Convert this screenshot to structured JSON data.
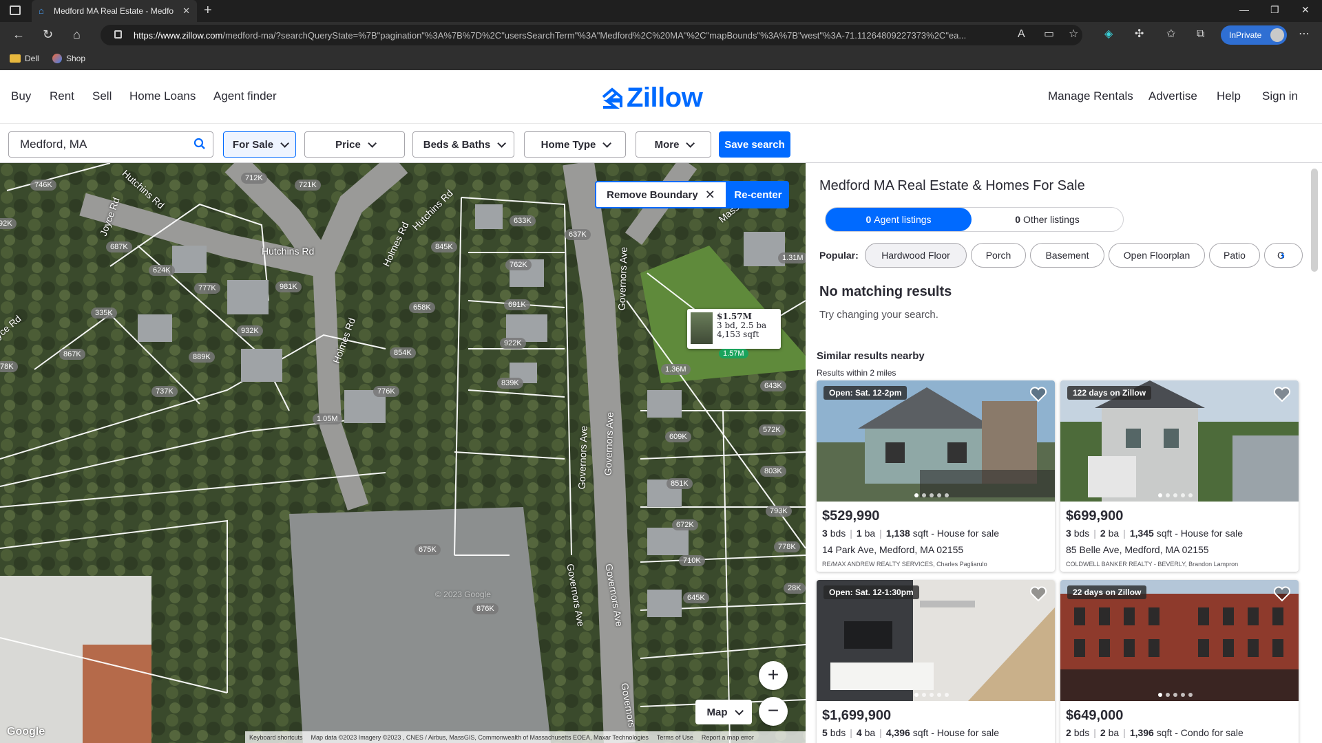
{
  "browser": {
    "tab_title": "Medford MA Real Estate - Medfo",
    "url_host": "https://www.zillow.com",
    "url_path": "/medford-ma/?searchQueryState=%7B\"pagination\"%3A%7B%7D%2C\"usersSearchTerm\"%3A\"Medford%2C%20MA\"%2C\"mapBounds\"%3A%7B\"west\"%3A-71.11264809227373%2C\"ea...",
    "inprivate_label": "InPrivate",
    "favorites": [
      "Dell",
      "Shop"
    ]
  },
  "header": {
    "nav_left": [
      "Buy",
      "Rent",
      "Sell",
      "Home Loans",
      "Agent finder"
    ],
    "logo_text": "Zillow",
    "nav_right": [
      "Manage Rentals",
      "Advertise",
      "Help",
      "Sign in"
    ]
  },
  "filters": {
    "search_value": "Medford, MA",
    "buttons": [
      "For Sale",
      "Price",
      "Beds & Baths",
      "Home Type",
      "More"
    ],
    "save_label": "Save search"
  },
  "map": {
    "remove_boundary": "Remove Boundary",
    "recenter": "Re-center",
    "map_type": "Map",
    "zoom_in": "+",
    "zoom_out": "−",
    "popup": {
      "price": "$1.57M",
      "beds_baths": "3 bd, 2.5 ba",
      "sqft": "4,153 sqft"
    },
    "green_pin": "1.57M",
    "price_labels": [
      "746K",
      "712K",
      "721K",
      "92K",
      "687K",
      "624K",
      "777K",
      "981K",
      "335K",
      "932K",
      "889K",
      "867K",
      "78K",
      "737K",
      "633K",
      "637K",
      "845K",
      "762K",
      "691K",
      "658K",
      "922K",
      "854K",
      "839K",
      "776K",
      "1.05M",
      "1.31M",
      "1.36M",
      "643K",
      "609K",
      "572K",
      "803K",
      "851K",
      "793K",
      "672K",
      "778K",
      "710K",
      "645K",
      "28K",
      "675K",
      "876K"
    ],
    "streets": [
      "Hutchins Rd",
      "Hutchins Rd",
      "Joyce Rd",
      "Hutchins Rd",
      "Holmes Rd",
      "Holmes Rd",
      "Governors Ave",
      "Governors Ave",
      "Governors Ave",
      "Governors Ave",
      "Governors Ave",
      "Governors",
      "Massac",
      "yce Rd"
    ],
    "watermark": "© 2023 Google",
    "google": "Google",
    "attribution": [
      "Keyboard shortcuts",
      "Map data ©2023 Imagery ©2023 , CNES / Airbus, MassGIS, Commonwealth of Massachusetts EOEA, Maxar Technologies",
      "Terms of Use",
      "Report a map error"
    ]
  },
  "panel": {
    "title": "Medford MA Real Estate & Homes For Sale",
    "agent_count": "0",
    "agent_label": "Agent listings",
    "other_count": "0",
    "other_label": "Other listings",
    "popular_label": "Popular:",
    "chips": [
      "Hardwood Floor",
      "Porch",
      "Basement",
      "Open Floorplan",
      "Patio",
      "G"
    ],
    "no_match": "No matching results",
    "try_change": "Try changing your search.",
    "similar": "Similar results nearby",
    "within": "Results within 2 miles",
    "cards": [
      {
        "badge": "Open: Sat. 12-2pm",
        "price": "$529,990",
        "beds": "3",
        "beds_u": "bds",
        "baths": "1",
        "baths_u": "ba",
        "sqft": "1,138",
        "sqft_u": "sqft",
        "type": "- House for sale",
        "address": "14 Park Ave, Medford, MA 02155",
        "brokerage": "RE/MAX ANDREW REALTY SERVICES,",
        "agent": "Charles Pagliarulo"
      },
      {
        "badge": "122 days on Zillow",
        "price": "$699,900",
        "beds": "3",
        "beds_u": "bds",
        "baths": "2",
        "baths_u": "ba",
        "sqft": "1,345",
        "sqft_u": "sqft",
        "type": "- House for sale",
        "address": "85 Belle Ave, Medford, MA 02155",
        "brokerage": "COLDWELL BANKER REALTY - BEVERLY,",
        "agent": "Brandon Lampron"
      },
      {
        "badge": "Open: Sat. 12-1:30pm",
        "price": "$1,699,900",
        "beds": "5",
        "beds_u": "bds",
        "baths": "4",
        "baths_u": "ba",
        "sqft": "4,396",
        "sqft_u": "sqft",
        "type": "- House for sale",
        "address": "",
        "brokerage": "",
        "agent": ""
      },
      {
        "badge": "22 days on Zillow",
        "price": "$649,000",
        "beds": "2",
        "beds_u": "bds",
        "baths": "2",
        "baths_u": "ba",
        "sqft": "1,396",
        "sqft_u": "sqft",
        "type": "- Condo for sale",
        "address": "",
        "brokerage": "",
        "agent": ""
      }
    ]
  },
  "colors": {
    "accent": "#006aff",
    "green_pin": "#1aa35c"
  }
}
